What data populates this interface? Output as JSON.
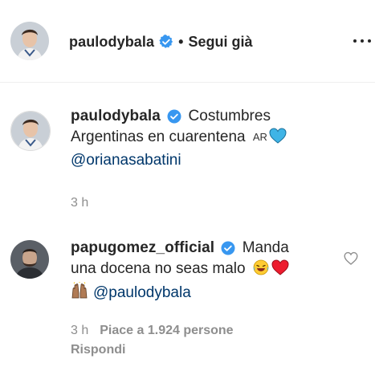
{
  "header": {
    "username": "paulodybala",
    "separator": "•",
    "follow_label": "Segui già"
  },
  "caption": {
    "username": "paulodybala",
    "text_line1": "Costumbres",
    "text_line2": "Argentinas en cuarentena",
    "flag_text": "AR",
    "mention": "@orianasabatini",
    "time": "3 h"
  },
  "comment": {
    "username": "papugomez_official",
    "text_line1": "Manda",
    "text_line2": "una docena no seas malo",
    "mention": "@paulodybala",
    "time": "3 h",
    "likes": "Piace a 1.924 persone",
    "reply_label": "Rispondi"
  },
  "colors": {
    "verified": "#3897f0",
    "mention": "#00376b",
    "muted": "#8e8e8e",
    "heart_red": "#ed1c2e",
    "heart_blue": "#3fb4e6"
  }
}
